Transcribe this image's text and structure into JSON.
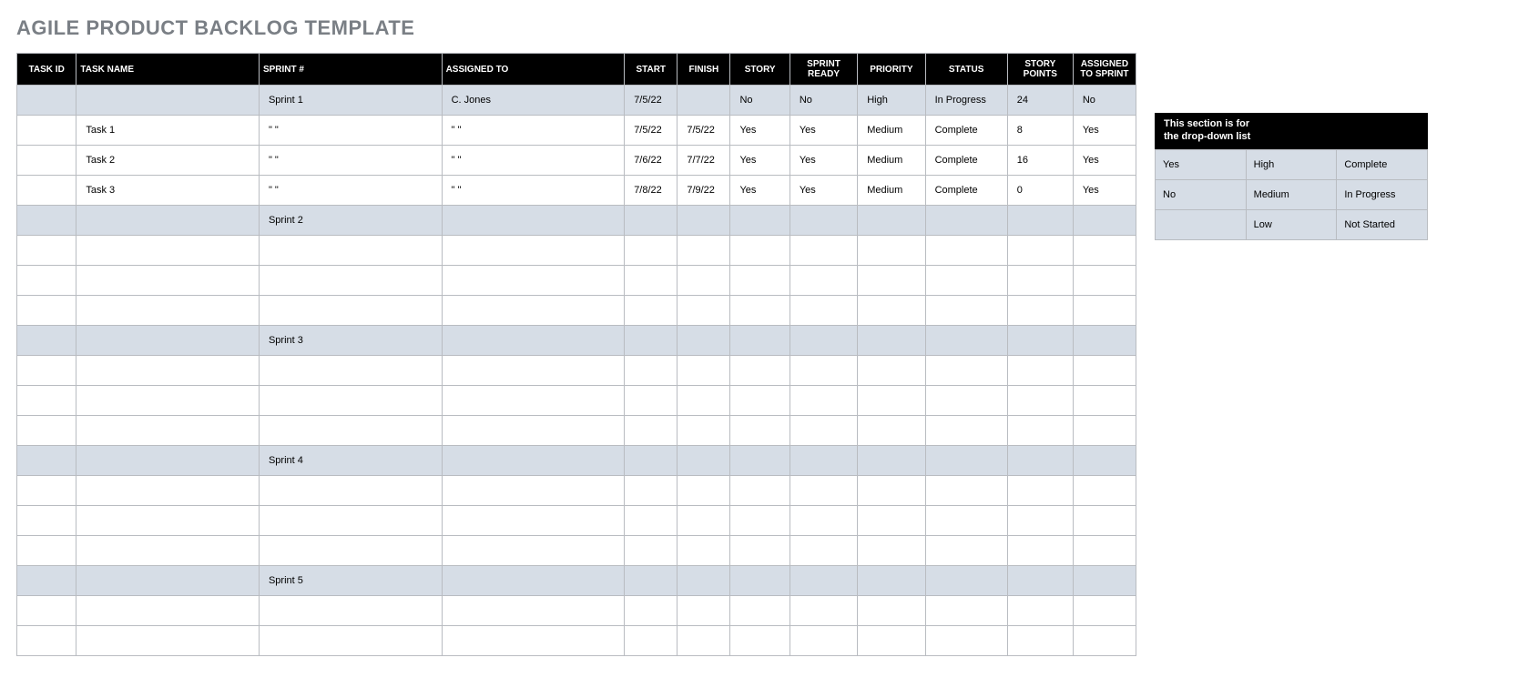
{
  "title": "AGILE PRODUCT BACKLOG TEMPLATE",
  "columns": [
    "TASK ID",
    "TASK NAME",
    "SPRINT #",
    "ASSIGNED TO",
    "START",
    "FINISH",
    "STORY",
    "SPRINT READY",
    "PRIORITY",
    "STATUS",
    "STORY POINTS",
    "ASSIGNED TO SPRINT"
  ],
  "rows": [
    {
      "sprint": true,
      "cells": [
        "",
        "",
        "Sprint 1",
        "C. Jones",
        "7/5/22",
        "",
        "No",
        "No",
        "High",
        "In Progress",
        "24",
        "No"
      ]
    },
    {
      "sprint": false,
      "cells": [
        "",
        "Task 1",
        "\" \"",
        "\" \"",
        "7/5/22",
        "7/5/22",
        "Yes",
        "Yes",
        "Medium",
        "Complete",
        "8",
        "Yes"
      ]
    },
    {
      "sprint": false,
      "cells": [
        "",
        "Task 2",
        "\" \"",
        "\" \"",
        "7/6/22",
        "7/7/22",
        "Yes",
        "Yes",
        "Medium",
        "Complete",
        "16",
        "Yes"
      ]
    },
    {
      "sprint": false,
      "cells": [
        "",
        "Task 3",
        "\" \"",
        "\" \"",
        "7/8/22",
        "7/9/22",
        "Yes",
        "Yes",
        "Medium",
        "Complete",
        "0",
        "Yes"
      ]
    },
    {
      "sprint": true,
      "cells": [
        "",
        "",
        "Sprint 2",
        "",
        "",
        "",
        "",
        "",
        "",
        "",
        "",
        ""
      ]
    },
    {
      "sprint": false,
      "cells": [
        "",
        "",
        "",
        "",
        "",
        "",
        "",
        "",
        "",
        "",
        "",
        ""
      ]
    },
    {
      "sprint": false,
      "cells": [
        "",
        "",
        "",
        "",
        "",
        "",
        "",
        "",
        "",
        "",
        "",
        ""
      ]
    },
    {
      "sprint": false,
      "cells": [
        "",
        "",
        "",
        "",
        "",
        "",
        "",
        "",
        "",
        "",
        "",
        ""
      ]
    },
    {
      "sprint": true,
      "cells": [
        "",
        "",
        "Sprint 3",
        "",
        "",
        "",
        "",
        "",
        "",
        "",
        "",
        ""
      ]
    },
    {
      "sprint": false,
      "cells": [
        "",
        "",
        "",
        "",
        "",
        "",
        "",
        "",
        "",
        "",
        "",
        ""
      ]
    },
    {
      "sprint": false,
      "cells": [
        "",
        "",
        "",
        "",
        "",
        "",
        "",
        "",
        "",
        "",
        "",
        ""
      ]
    },
    {
      "sprint": false,
      "cells": [
        "",
        "",
        "",
        "",
        "",
        "",
        "",
        "",
        "",
        "",
        "",
        ""
      ]
    },
    {
      "sprint": true,
      "cells": [
        "",
        "",
        "Sprint 4",
        "",
        "",
        "",
        "",
        "",
        "",
        "",
        "",
        ""
      ]
    },
    {
      "sprint": false,
      "cells": [
        "",
        "",
        "",
        "",
        "",
        "",
        "",
        "",
        "",
        "",
        "",
        ""
      ]
    },
    {
      "sprint": false,
      "cells": [
        "",
        "",
        "",
        "",
        "",
        "",
        "",
        "",
        "",
        "",
        "",
        ""
      ]
    },
    {
      "sprint": false,
      "cells": [
        "",
        "",
        "",
        "",
        "",
        "",
        "",
        "",
        "",
        "",
        "",
        ""
      ]
    },
    {
      "sprint": true,
      "cells": [
        "",
        "",
        "Sprint 5",
        "",
        "",
        "",
        "",
        "",
        "",
        "",
        "",
        ""
      ]
    },
    {
      "sprint": false,
      "cells": [
        "",
        "",
        "",
        "",
        "",
        "",
        "",
        "",
        "",
        "",
        "",
        ""
      ]
    },
    {
      "sprint": false,
      "cells": [
        "",
        "",
        "",
        "",
        "",
        "",
        "",
        "",
        "",
        "",
        "",
        ""
      ]
    }
  ],
  "dropdown": {
    "heading": "This section is for\nthe drop-down list",
    "grid": [
      [
        "Yes",
        "High",
        "Complete"
      ],
      [
        "No",
        "Medium",
        "In Progress"
      ],
      [
        "",
        "Low",
        "Not Started"
      ]
    ]
  }
}
